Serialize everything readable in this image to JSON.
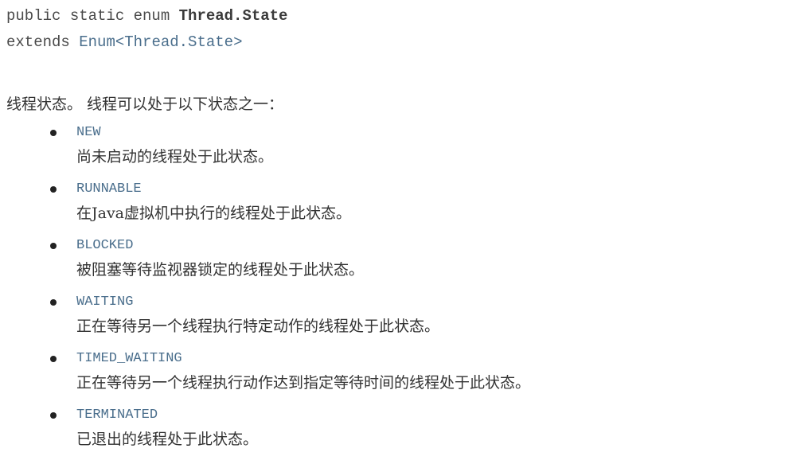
{
  "signature": {
    "modifiers": "public static enum",
    "class_name": "Thread.State",
    "extends_keyword": "extends",
    "extends_type": "Enum<Thread.State>"
  },
  "description": "线程状态。 线程可以处于以下状态之一：",
  "states": [
    {
      "name": "NEW",
      "desc": "尚未启动的线程处于此状态。"
    },
    {
      "name": "RUNNABLE",
      "desc": "在Java虚拟机中执行的线程处于此状态。"
    },
    {
      "name": "BLOCKED",
      "desc": "被阻塞等待监视器锁定的线程处于此状态。"
    },
    {
      "name": "WAITING",
      "desc": "正在等待另一个线程执行特定动作的线程处于此状态。"
    },
    {
      "name": "TIMED_WAITING",
      "desc": "正在等待另一个线程执行动作达到指定等待时间的线程处于此状态。"
    },
    {
      "name": "TERMINATED",
      "desc": "已退出的线程处于此状态。"
    }
  ],
  "colors": {
    "text": "#333333",
    "link_code": "#4a6e8c",
    "bullet": "#222222"
  }
}
